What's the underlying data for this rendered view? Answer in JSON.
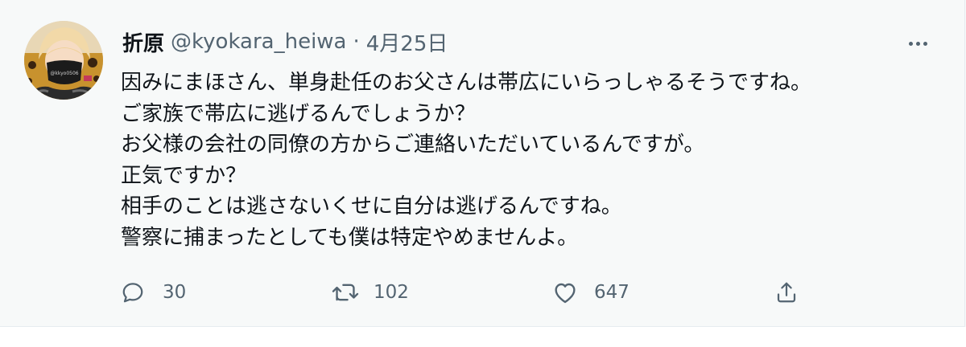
{
  "tweet": {
    "display_name": "折原",
    "handle": "@kyokara_heiwa",
    "separator": "·",
    "date": "4月25日",
    "avatar_text": "@kkyo0506",
    "lines": [
      "因みにまほさん、単身赴任のお父さんは帯広にいらっしゃるそうですね。",
      "ご家族で帯広に逃げるんでしょうか？",
      "お父様の会社の同僚の方からご連絡いただいているんですが。",
      "正気ですか？",
      "相手のことは逃さないくせに自分は逃げるんですね。",
      "警察に捕まったとしても僕は特定やめませんよ。"
    ]
  },
  "actions": {
    "reply_icon": "reply-icon",
    "reply_count": "30",
    "retweet_icon": "retweet-icon",
    "retweet_count": "102",
    "like_icon": "heart-icon",
    "like_count": "647",
    "share_icon": "share-icon"
  },
  "colors": {
    "background": "#f7f9f9",
    "text": "#0f1419",
    "secondary_text": "#536471"
  }
}
